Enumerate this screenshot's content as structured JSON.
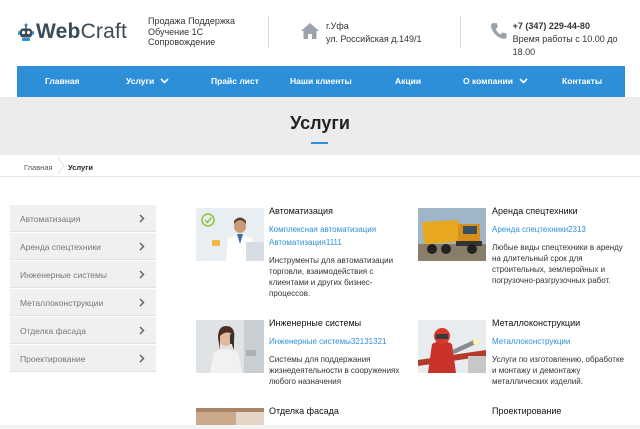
{
  "header": {
    "logo": {
      "web": "Web",
      "craft": "Craft"
    },
    "tagline": [
      "Продажа Поддержка",
      "Обучение 1С",
      "Сопровождение"
    ],
    "address": {
      "city": "г.Уфа",
      "street": "ул. Российская д.149/1"
    },
    "phone": {
      "number": "+7 (347) 229-44-80",
      "hours": "Время работы с 10.00 до 18.00"
    }
  },
  "nav": {
    "items": [
      {
        "label": "Главная"
      },
      {
        "label": "Услуги"
      },
      {
        "label": "Прайс лист"
      },
      {
        "label": "Наши клиенты"
      },
      {
        "label": "Акции"
      },
      {
        "label": "О компании"
      },
      {
        "label": "Контакты"
      }
    ]
  },
  "hero": {
    "title": "Услуги"
  },
  "breadcrumb": {
    "home": "Главная",
    "current": "Услуги"
  },
  "sidebar": {
    "items": [
      {
        "label": "Автоматизация"
      },
      {
        "label": "Аренда спецтехники"
      },
      {
        "label": "Инженерные системы"
      },
      {
        "label": "Металлоконструкции"
      },
      {
        "label": "Отделка фасада"
      },
      {
        "label": "Проектирование"
      }
    ]
  },
  "services": [
    {
      "title": "Автоматизация",
      "links": [
        "Комплексная автоматизация",
        "Автоматизация1111"
      ],
      "desc": [
        "Инструменты для автоматизации",
        "торговли, взаимодействия с",
        "клиентами и других бизнес-",
        "процессов."
      ]
    },
    {
      "title": "Аренда спецтехники",
      "links": [
        "Аренда спецтехники2313"
      ],
      "desc": [
        "Любые виды спецтехники в аренду",
        "на длительный срок для",
        "строительных, землеройных и",
        "погрузочно-разгрузочных работ."
      ]
    },
    {
      "title": "Инженерные системы",
      "links": [
        "Инженерные системы32131321"
      ],
      "desc": [
        "Системы для поддержания",
        "жизнедеятельности в сооружениях",
        "любого назначения"
      ]
    },
    {
      "title": "Металлоконструкции",
      "links": [
        "Металлоконструкции"
      ],
      "desc": [
        "Услуги по изготовлению, обработке",
        "и монтажу и демонтажу",
        "металлических изделий."
      ]
    },
    {
      "title": "Отделка фасада",
      "links": [],
      "desc": []
    },
    {
      "title": "Проектирование",
      "links": [],
      "desc": []
    }
  ],
  "colors": {
    "accent": "#2e8fd9",
    "sidebar_bg": "#f0f0f0",
    "hero_bg": "#ececec"
  }
}
